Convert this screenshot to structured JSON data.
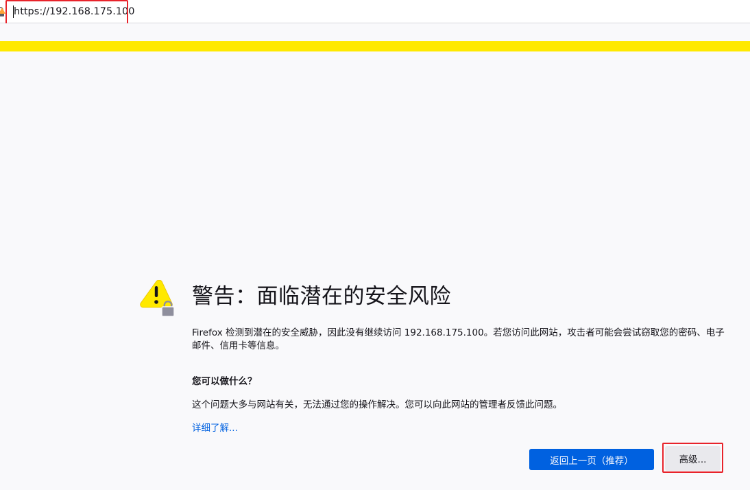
{
  "address_bar": {
    "url": "https://192.168.175.100",
    "insecure_icon": "lock-warning-icon"
  },
  "error_page": {
    "icon": "warning-triangle-lock-icon",
    "title": "警告：面临潜在的安全风险",
    "description": "Firefox 检测到潜在的安全威胁，因此没有继续访问 192.168.175.100。若您访问此网站，攻击者可能会尝试窃取您的密码、电子邮件、信用卡等信息。",
    "what_can_you_do": "您可以做什么？",
    "advice": "这个问题大多与网站有关，无法通过您的操作解决。您可以向此网站的管理者反馈此问题。",
    "learn_more": "详细了解...",
    "go_back_button": "返回上一页（推荐）",
    "advanced_button": "高级..."
  },
  "colors": {
    "warning_strip": "#ffe900",
    "primary_button": "#0061e0",
    "link": "#0061e0",
    "highlight_box": "#e8232b"
  }
}
